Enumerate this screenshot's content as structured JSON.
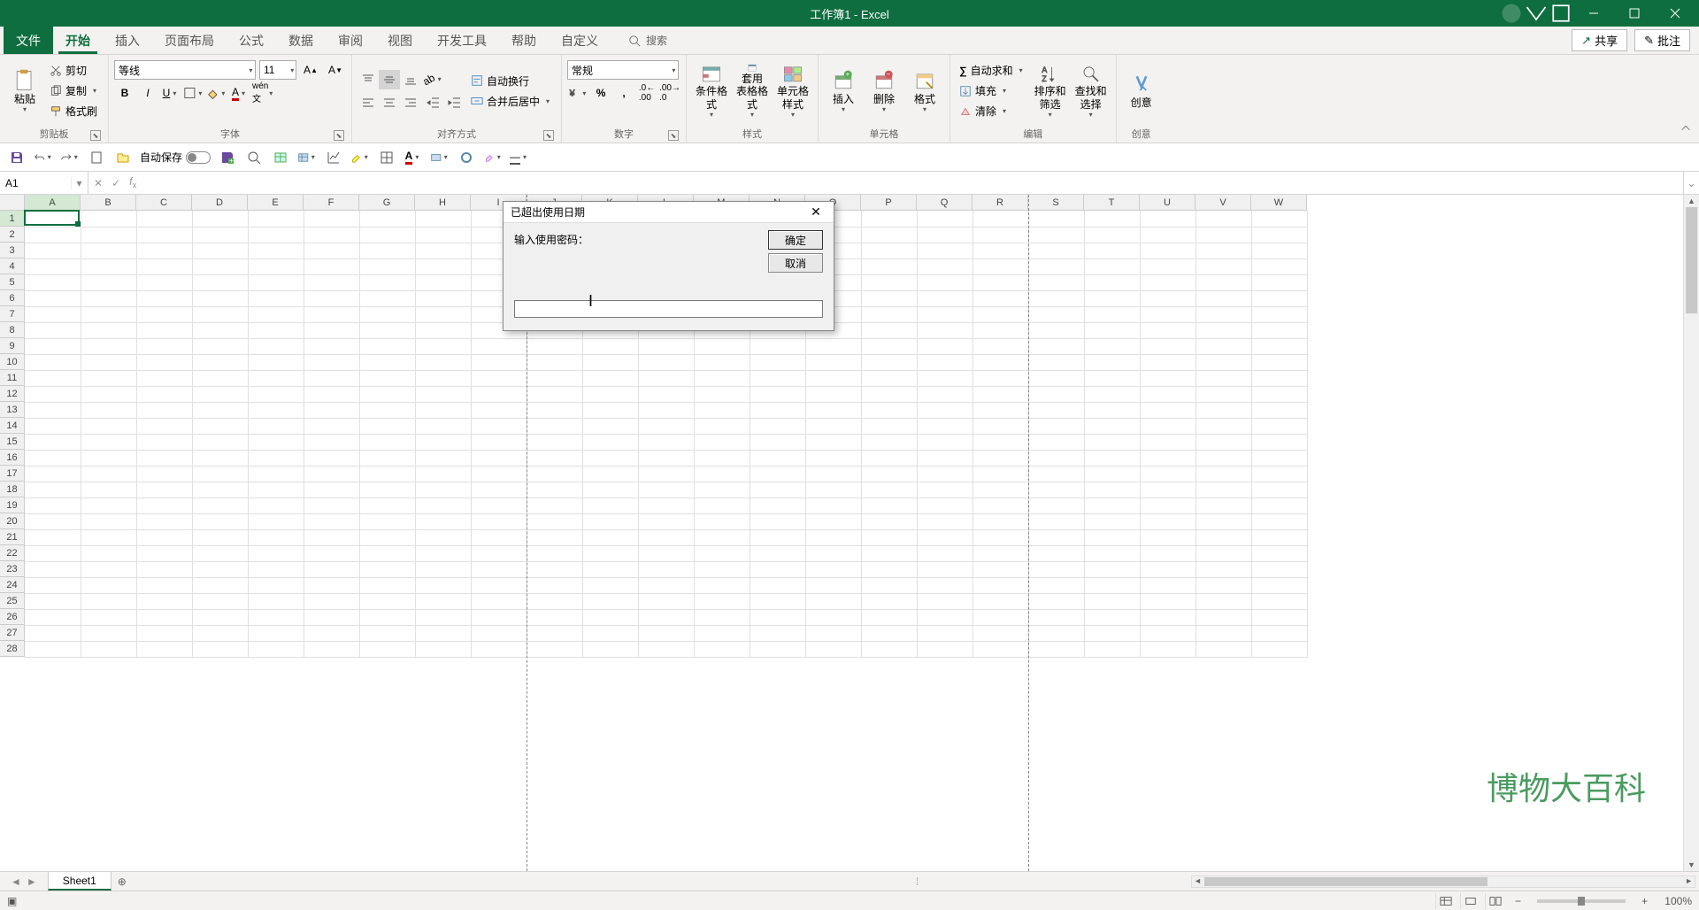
{
  "titlebar": {
    "title": "工作簿1 - Excel"
  },
  "tabs": {
    "file": "文件",
    "home": "开始",
    "insert": "插入",
    "layout": "页面布局",
    "formulas": "公式",
    "data": "数据",
    "review": "审阅",
    "view": "视图",
    "dev": "开发工具",
    "help": "帮助",
    "custom": "自定义",
    "search_placeholder": "搜索",
    "share": "共享",
    "comments": "批注"
  },
  "ribbon": {
    "clipboard": {
      "paste": "粘贴",
      "cut": "剪切",
      "copy": "复制",
      "painter": "格式刷",
      "label": "剪贴板"
    },
    "font": {
      "name": "等线",
      "size": "11",
      "label": "字体"
    },
    "align": {
      "wrap": "自动换行",
      "merge": "合并后居中",
      "label": "对齐方式"
    },
    "number": {
      "format": "常规",
      "label": "数字"
    },
    "styles": {
      "cond": "条件格式",
      "table": "套用\n表格格式",
      "cell": "单元格样式",
      "label": "样式"
    },
    "cells": {
      "insert": "插入",
      "delete": "删除",
      "format": "格式",
      "label": "单元格"
    },
    "editing": {
      "sum": "自动求和",
      "fill": "填充",
      "clear": "清除",
      "sort": "排序和筛选",
      "find": "查找和选择",
      "label": "编辑"
    },
    "ideas": {
      "label_btn": "创意",
      "label": "创意"
    }
  },
  "qat": {
    "autosave": "自动保存"
  },
  "namebox": {
    "value": "A1"
  },
  "columns": [
    "A",
    "B",
    "C",
    "D",
    "E",
    "F",
    "G",
    "H",
    "I",
    "J",
    "K",
    "L",
    "M",
    "N",
    "O",
    "P",
    "Q",
    "R",
    "S",
    "T",
    "U",
    "V",
    "W"
  ],
  "rows": [
    "1",
    "2",
    "3",
    "4",
    "5",
    "6",
    "7",
    "8",
    "9",
    "10",
    "11",
    "12",
    "13",
    "14",
    "15",
    "16",
    "17",
    "18",
    "19",
    "20",
    "21",
    "22",
    "23",
    "24",
    "25",
    "26",
    "27",
    "28"
  ],
  "sheet": {
    "name": "Sheet1"
  },
  "status": {
    "zoom": "100%"
  },
  "dialog": {
    "title": "已超出使用日期",
    "prompt": "输入使用密码：",
    "ok": "确定",
    "cancel": "取消",
    "value": ""
  },
  "watermark": "博物大百科"
}
